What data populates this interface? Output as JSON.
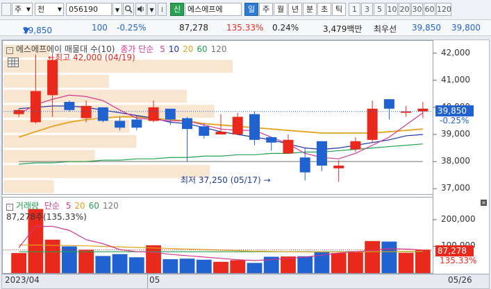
{
  "toolbar": {
    "market": "주",
    "jeon": "전",
    "code": "056190",
    "sin_label": "신",
    "stock_name": "에스에프에",
    "periods_kr": [
      "일",
      "주",
      "월",
      "년",
      "분",
      "초",
      "틱"
    ],
    "periods_num": [
      "1",
      "3",
      "5",
      "10",
      "20",
      "30",
      "60",
      "120"
    ]
  },
  "info": {
    "price": "39,850",
    "change": "100",
    "change_pct": "-0.25%",
    "volume": "87,278",
    "volume_ratio": "135.33%",
    "turnover": "0.24%",
    "amount": "3,479백만",
    "best_ask_label": "최우선",
    "ask": "39,850",
    "bid": "39,800"
  },
  "price_legend": {
    "name": "에스에프에이 매물대 수(10)",
    "ma_label": "종가 단순",
    "ma_periods": [
      "5",
      "10",
      "20",
      "60",
      "120"
    ],
    "colors": [
      "#d6358f",
      "#1c2fb0",
      "#e3a21a",
      "#21a050",
      "#777777"
    ]
  },
  "annotations": {
    "high": "최고 42,000 (04/19)",
    "low": "최저 37,250 (05/17)"
  },
  "current_price_label": "39,850",
  "current_change_label": "-0.25%",
  "price_axis": [
    "42,000",
    "41,000",
    "40,000",
    "39,000",
    "38,000",
    "37,000"
  ],
  "volume_legend": {
    "name": "거래량",
    "ma_label": "단순",
    "ma_periods": [
      "5",
      "20",
      "60",
      "120"
    ],
    "value_text": "87,278주(135.33%)"
  },
  "volume_axis": [
    "200,000",
    "100,000"
  ],
  "volume_current_label": "87,278",
  "volume_current_pct": "135.33%",
  "date_axis": [
    "2023/04",
    "05",
    "05/26"
  ],
  "colors": {
    "up": "#e8291c",
    "down": "#1f62d0"
  },
  "chart_data": {
    "type": "candlestick",
    "ylim": [
      36800,
      42350
    ],
    "candles": [
      {
        "o": 39750,
        "h": 39950,
        "l": 39650,
        "c": 39900
      },
      {
        "o": 39450,
        "h": 41950,
        "l": 39400,
        "c": 40600
      },
      {
        "o": 40450,
        "h": 42000,
        "l": 39650,
        "c": 41750
      },
      {
        "o": 40200,
        "h": 40250,
        "l": 39850,
        "c": 39900
      },
      {
        "o": 39600,
        "h": 40250,
        "l": 39450,
        "c": 40050
      },
      {
        "o": 40000,
        "h": 40000,
        "l": 39450,
        "c": 39500
      },
      {
        "o": 39500,
        "h": 39650,
        "l": 39150,
        "c": 39250
      },
      {
        "o": 39550,
        "h": 39700,
        "l": 39150,
        "c": 39250
      },
      {
        "o": 39500,
        "h": 40250,
        "l": 39450,
        "c": 40000
      },
      {
        "o": 39950,
        "h": 39950,
        "l": 39350,
        "c": 39550
      },
      {
        "o": 39600,
        "h": 39650,
        "l": 38000,
        "c": 39200
      },
      {
        "o": 39300,
        "h": 39400,
        "l": 38850,
        "c": 38950
      },
      {
        "o": 39000,
        "h": 39750,
        "l": 39000,
        "c": 39100
      },
      {
        "o": 39000,
        "h": 39800,
        "l": 39000,
        "c": 39650
      },
      {
        "o": 39750,
        "h": 39850,
        "l": 38600,
        "c": 38800
      },
      {
        "o": 38900,
        "h": 38900,
        "l": 38400,
        "c": 38700
      },
      {
        "o": 38300,
        "h": 39000,
        "l": 38300,
        "c": 38800
      },
      {
        "o": 38150,
        "h": 38500,
        "l": 37300,
        "c": 37600
      },
      {
        "o": 38750,
        "h": 38750,
        "l": 37650,
        "c": 37850
      },
      {
        "o": 37750,
        "h": 38050,
        "l": 37250,
        "c": 37850
      },
      {
        "o": 38450,
        "h": 38900,
        "l": 38350,
        "c": 38750
      },
      {
        "o": 38800,
        "h": 40250,
        "l": 38700,
        "c": 39950
      },
      {
        "o": 40300,
        "h": 40300,
        "l": 39550,
        "c": 39950
      },
      {
        "o": 39800,
        "h": 40050,
        "l": 39650,
        "c": 39850
      },
      {
        "o": 39850,
        "h": 40200,
        "l": 39600,
        "c": 39950
      }
    ],
    "ma5": [
      39750,
      40100,
      40300,
      40450,
      40400,
      40250,
      39900,
      39600,
      39550,
      39500,
      39500,
      39350,
      39200,
      39150,
      39150,
      38900,
      38650,
      38300,
      38150,
      38100,
      38300,
      38600,
      38900,
      39350,
      39800
    ],
    "ma10": [
      39950,
      40000,
      40050,
      40050,
      40000,
      39900,
      39800,
      39700,
      39600,
      39450,
      39400,
      39250,
      39100,
      39000,
      38900,
      38800,
      38650,
      38500,
      38450,
      38500,
      38600,
      38700,
      38800,
      38950,
      39000
    ],
    "ma20": [
      38900,
      39100,
      39300,
      39450,
      39550,
      39600,
      39650,
      39650,
      39600,
      39550,
      39500,
      39400,
      39350,
      39300,
      39250,
      39200,
      39150,
      39100,
      39050,
      39050,
      39050,
      39050,
      39100,
      39150,
      39200
    ],
    "ma60": [
      37900,
      37950,
      37950,
      38000,
      38000,
      38050,
      38050,
      38100,
      38100,
      38150,
      38150,
      38200,
      38200,
      38250,
      38250,
      38300,
      38300,
      38350,
      38350,
      38400,
      38450,
      38500,
      38550,
      38600,
      38650
    ],
    "ma120": [
      38000,
      38000,
      38000,
      38000,
      38000,
      38000,
      38000,
      38000,
      38000,
      38000,
      38000,
      38000,
      38000,
      38000,
      38000,
      38000,
      38000,
      38000,
      38000,
      38000,
      38000,
      38000,
      38000,
      38000,
      38000
    ],
    "volume_profile": [
      20,
      100,
      46,
      80,
      92,
      55,
      58,
      40,
      90,
      22
    ],
    "volume": [
      75000,
      240000,
      125000,
      100000,
      87000,
      64000,
      71000,
      59000,
      104000,
      52000,
      54000,
      50000,
      42000,
      48000,
      38000,
      61000,
      62000,
      63000,
      80000,
      75000,
      82000,
      120000,
      118000,
      76000,
      87278
    ],
    "vol_ma5": [
      95000,
      175000,
      175000,
      160000,
      125000,
      110000,
      88000,
      80000,
      78000,
      70000,
      65000,
      60000,
      55000,
      50000,
      47000,
      50000,
      55000,
      60000,
      67000,
      75000,
      80000,
      85000,
      92000,
      90000,
      86000
    ],
    "vol_ma20": [
      105000,
      105000,
      104000,
      103000,
      102000,
      100000,
      98000,
      96000,
      94000,
      92000,
      90000,
      88000,
      86000,
      84000,
      82000,
      81000,
      80000,
      79000,
      79000,
      79000,
      79000,
      80000,
      80000,
      81000,
      81000
    ],
    "vol_ma60": [
      80000,
      80000,
      80000,
      80000,
      80000,
      80000,
      80000,
      80000,
      80000,
      80000,
      80000,
      80000,
      80000,
      80000,
      80000,
      80000,
      80000,
      80000,
      80000,
      80000,
      80000,
      80000,
      80000,
      80000,
      80000
    ],
    "vol_ylim": [
      0,
      270000
    ]
  }
}
